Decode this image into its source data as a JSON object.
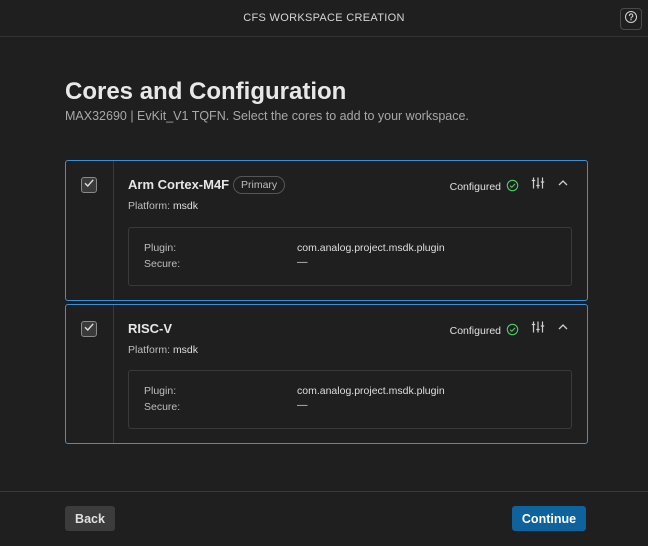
{
  "window": {
    "title": "CFS WORKSPACE CREATION",
    "help_icon": "help-circle-icon"
  },
  "header": {
    "title": "Cores and Configuration",
    "subtitle": "MAX32690 | EvKit_V1 TQFN. Select the cores to add to your workspace."
  },
  "cores": [
    {
      "name": "Arm Cortex-M4F",
      "badge": "Primary",
      "checked": true,
      "platform_label": "Platform:",
      "platform_value": "msdk",
      "status": "Configured",
      "plugin_label": "Plugin:",
      "plugin_value": "com.analog.project.msdk.plugin",
      "secure_label": "Secure:",
      "secure_value": "—"
    },
    {
      "name": "RISC-V",
      "checked": true,
      "platform_label": "Platform:",
      "platform_value": "msdk",
      "status": "Configured",
      "plugin_label": "Plugin:",
      "plugin_value": "com.analog.project.msdk.plugin",
      "secure_label": "Secure:",
      "secure_value": "—"
    }
  ],
  "footer": {
    "back_label": "Back",
    "continue_label": "Continue"
  },
  "colors": {
    "accent": "#3f8fd8",
    "primary_button": "#0e639c",
    "success": "#4ec96b"
  }
}
